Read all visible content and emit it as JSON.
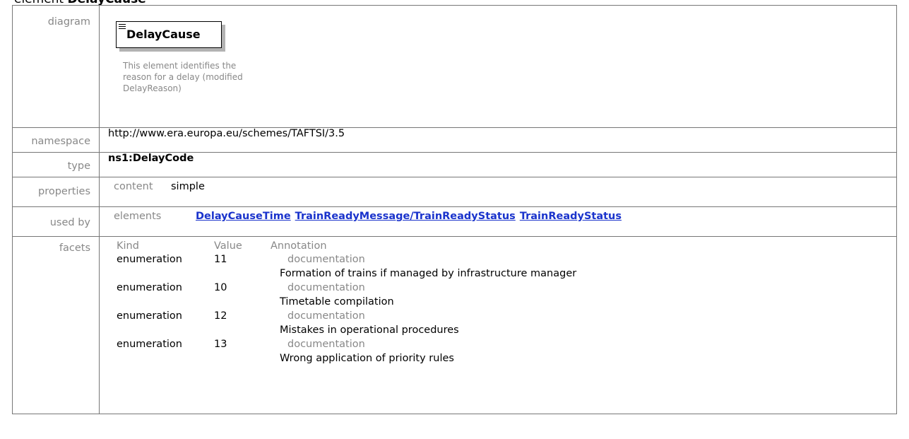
{
  "title": {
    "prefix": "element",
    "name": "DelayCause"
  },
  "rows": {
    "diagram": {
      "label": "diagram",
      "element_name": "DelayCause",
      "documentation": "This element identifies the reason for a delay (modified DelayReason)"
    },
    "namespace": {
      "label": "namespace",
      "value": "http://www.era.europa.eu/schemes/TAFTSI/3.5"
    },
    "type": {
      "label": "type",
      "value": "ns1:DelayCode"
    },
    "properties": {
      "label": "properties",
      "key": "content",
      "value": "simple"
    },
    "used_by": {
      "label": "used by",
      "key": "elements",
      "links": [
        "DelayCauseTime",
        "TrainReadyMessage/TrainReadyStatus",
        "TrainReadyStatus"
      ]
    },
    "facets": {
      "label": "facets",
      "headers": {
        "kind": "Kind",
        "value": "Value",
        "annotation": "Annotation"
      },
      "items": [
        {
          "kind": "enumeration",
          "value": "11",
          "doc_label": "documentation",
          "doc": "Formation of trains if managed by infrastructure manager"
        },
        {
          "kind": "enumeration",
          "value": "10",
          "doc_label": "documentation",
          "doc": "Timetable compilation"
        },
        {
          "kind": "enumeration",
          "value": "12",
          "doc_label": "documentation",
          "doc": "Mistakes in operational procedures"
        },
        {
          "kind": "enumeration",
          "value": "13",
          "doc_label": "documentation",
          "doc": "Wrong application of priority rules"
        }
      ]
    }
  }
}
